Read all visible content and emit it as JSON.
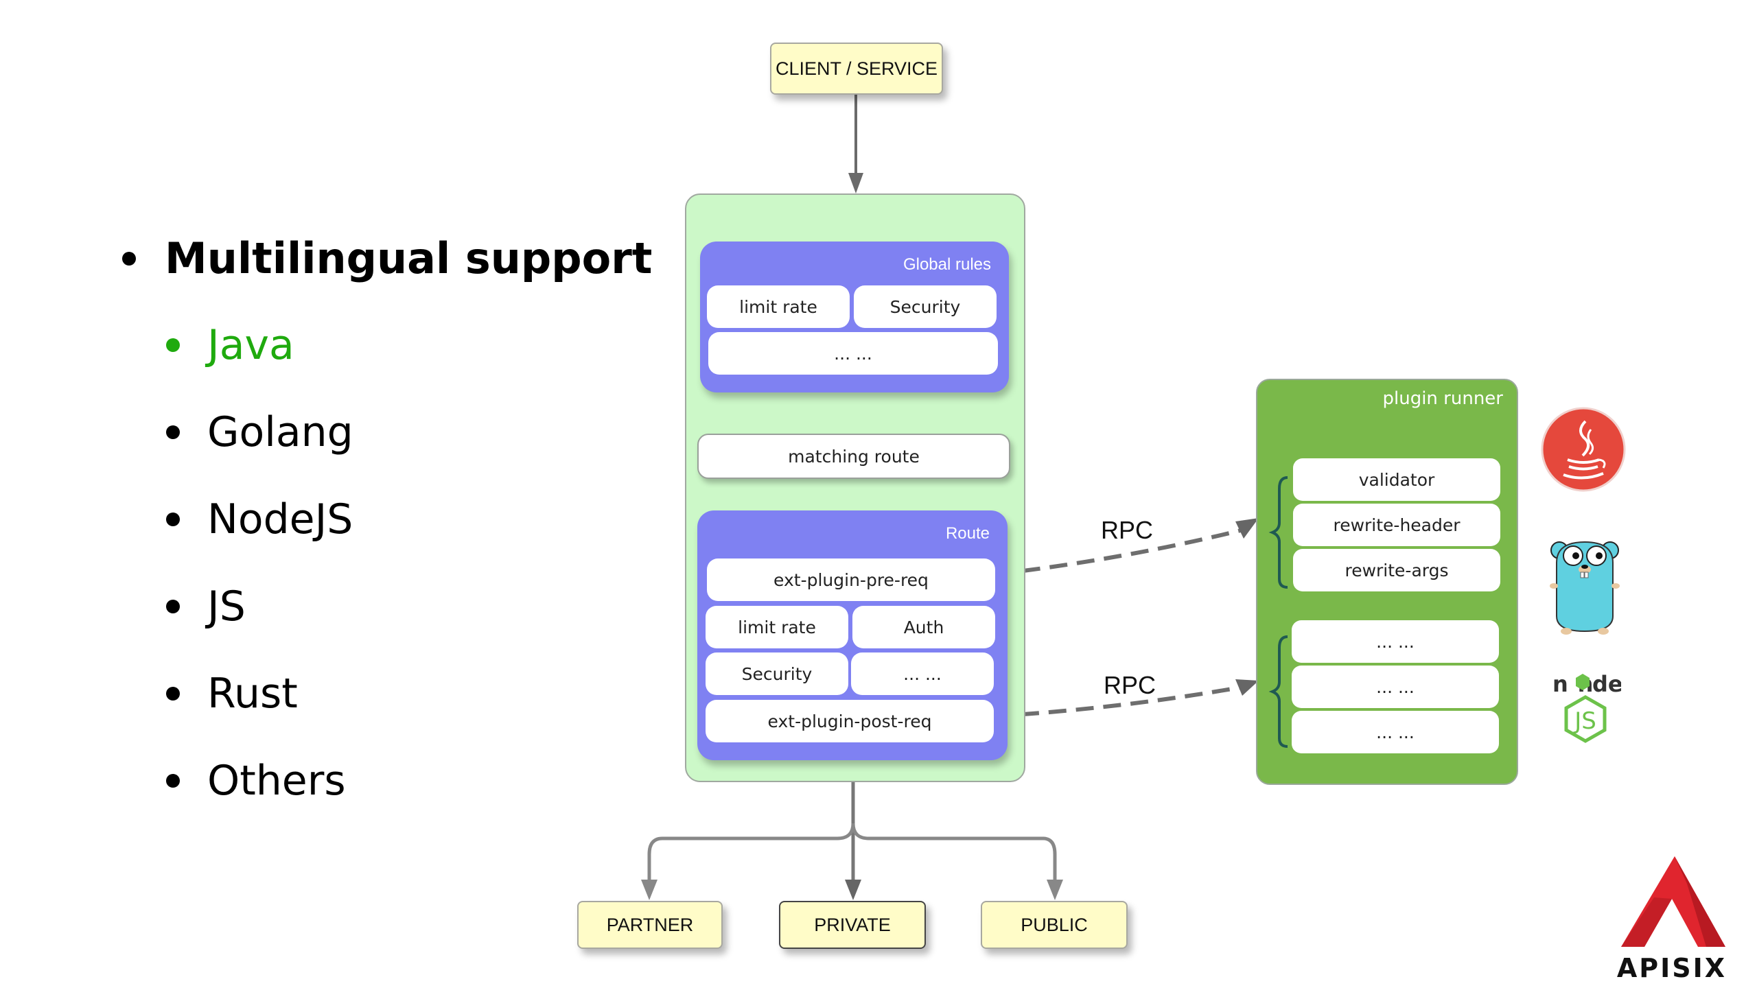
{
  "slide": {
    "heading": "Multilingual support",
    "languages": [
      {
        "label": "Java",
        "active": true
      },
      {
        "label": "Golang",
        "active": false
      },
      {
        "label": "NodeJS",
        "active": false
      },
      {
        "label": "JS",
        "active": false
      },
      {
        "label": "Rust",
        "active": false
      },
      {
        "label": "Others",
        "active": false
      }
    ],
    "accent_color": "#1faa0e"
  },
  "diagram": {
    "client": "CLIENT / SERVICE",
    "global_rules": {
      "title": "Global rules",
      "cells": [
        "limit rate",
        "Security",
        "... ..."
      ]
    },
    "matching_route": "matching route",
    "route": {
      "title": "Route",
      "cells": [
        "ext-plugin-pre-req",
        "limit rate",
        "Auth",
        "Security",
        "... ...",
        "ext-plugin-post-req"
      ]
    },
    "rpc_labels": [
      "RPC",
      "RPC"
    ],
    "plugin_runner": {
      "title": "plugin runner",
      "group1": [
        "validator",
        "rewrite-header",
        "rewrite-args"
      ],
      "group2": [
        "... ...",
        "... ...",
        "... ..."
      ]
    },
    "upstreams": [
      "PARTNER",
      "PRIVATE",
      "PUBLIC"
    ],
    "language_icons": [
      "java-icon",
      "golang-gopher-icon",
      "nodejs-icon"
    ],
    "colors": {
      "container": "#ccf8c8",
      "purple": "#7f81f2",
      "runner": "#7ab84a",
      "note": "#fffcc8"
    }
  },
  "brand": {
    "logo_text": "APISIX"
  }
}
